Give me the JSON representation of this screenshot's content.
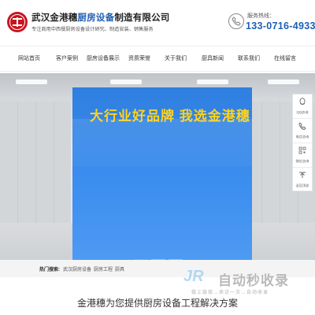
{
  "header": {
    "company_name_prefix": "武汉金港穗",
    "company_name_accent": "厨房设备",
    "company_name_suffix": "制造有限公司",
    "company_subtitle": "专注商用中西餐厨房设备设计研究、制造安装、销售服务",
    "hotline_label": "服务热线：",
    "hotline_number": "133-0716-4933"
  },
  "nav": {
    "items": [
      {
        "label": "网站首页"
      },
      {
        "label": "客户案例"
      },
      {
        "label": "厨房设备展示"
      },
      {
        "label": "资质荣誉"
      },
      {
        "label": "关于我们"
      },
      {
        "label": "厨具新闻"
      },
      {
        "label": "联系我们"
      },
      {
        "label": "在线留言"
      }
    ]
  },
  "banner": {
    "slogan": "大行业好品牌 我选金港穗"
  },
  "float_bar": {
    "items": [
      {
        "label": "QQ咨询",
        "icon": "qq-icon"
      },
      {
        "label": "电话咨询",
        "icon": "phone-icon"
      },
      {
        "label": "微信咨询",
        "icon": "wechat-icon"
      },
      {
        "label": "返回顶部",
        "icon": "arrow-up-icon"
      }
    ]
  },
  "breadcrumb": {
    "label": "热门搜索:",
    "links": [
      "武汉厨房设备",
      "厨房工程",
      "厨具"
    ]
  },
  "section": {
    "title": "金港穗为您提供厨房设备工程解决方案"
  },
  "watermark": {
    "brand": "自动秒收录",
    "slogan": "做上链接→来访一次→自动收录"
  },
  "colors": {
    "brand_red": "#c9151e",
    "brand_blue": "#1d5fb4",
    "banner_blue": "#3d8ff0",
    "slogan_yellow": "#ffd21c",
    "slider_active": "#f08b18"
  }
}
